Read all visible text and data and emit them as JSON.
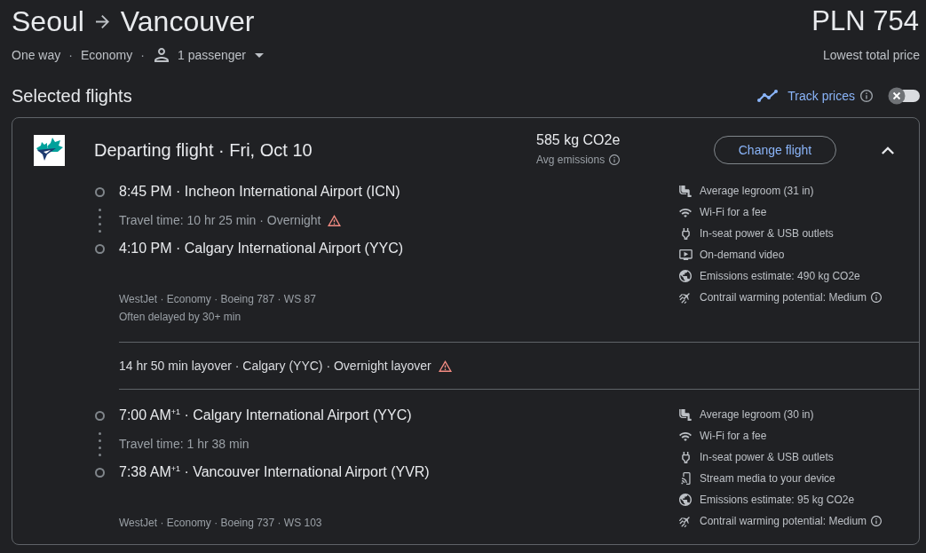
{
  "route": {
    "origin": "Seoul",
    "destination": "Vancouver"
  },
  "price": {
    "amount": "PLN 754",
    "note": "Lowest total price"
  },
  "trip_summary": [
    {
      "kind": "option",
      "label": "One way"
    },
    {
      "kind": "separator",
      "label": "·"
    },
    {
      "kind": "option",
      "label": "Economy"
    },
    {
      "kind": "separator",
      "label": "·"
    },
    {
      "kind": "passengers",
      "label": "1 passenger"
    }
  ],
  "section_title": "Selected flights",
  "track_prices": {
    "label": "Track prices",
    "on": false
  },
  "flight_card": {
    "title": "Departing flight · Fri, Oct 10",
    "emissions": {
      "value": "585 kg CO2e",
      "label": "Avg emissions"
    },
    "change_button": "Change flight",
    "expanded": true,
    "segments": [
      {
        "kind": "leg",
        "departure": "8:45 PM · Incheon International Airport (ICN)",
        "travel_time": "Travel time: 10 hr 25 min · Overnight",
        "overnight_warning": true,
        "arrival": "4:10 PM · Calgary International Airport (YYC)",
        "details": [
          "WestJet · Economy · Boeing 787 · WS 87",
          "Often delayed by 30+ min"
        ],
        "amenities": [
          {
            "kind": "legroom",
            "label": "Average legroom (31 in)",
            "info": false
          },
          {
            "kind": "wifi",
            "label": "Wi-Fi for a fee",
            "info": false
          },
          {
            "kind": "power",
            "label": "In-seat power & USB outlets",
            "info": false
          },
          {
            "kind": "video",
            "label": "On-demand video",
            "info": false
          },
          {
            "kind": "emissions",
            "label": "Emissions estimate: 490 kg CO2e",
            "info": false
          },
          {
            "kind": "contrail",
            "label": "Contrail warming potential: Medium",
            "info": true
          }
        ]
      },
      {
        "kind": "layover",
        "label": "14 hr 50 min layover · Calgary (YYC) · Overnight layover",
        "warning": true
      },
      {
        "kind": "leg",
        "departure": "7:00 AM$^{+1}$ · Calgary International Airport (YYC)",
        "travel_time": "Travel time: 1 hr 38 min",
        "overnight_warning": false,
        "arrival": "7:38 AM$^{+1}$ · Vancouver International Airport (YVR)",
        "details": [
          "WestJet · Economy · Boeing 737 · WS 103"
        ],
        "amenities": [
          {
            "kind": "legroom",
            "label": "Average legroom (30 in)",
            "info": false
          },
          {
            "kind": "wifi",
            "label": "Wi-Fi for a fee",
            "info": false
          },
          {
            "kind": "power",
            "label": "In-seat power & USB outlets",
            "info": false
          },
          {
            "kind": "stream",
            "label": "Stream media to your device",
            "info": false
          },
          {
            "kind": "emissions",
            "label": "Emissions estimate: 95 kg CO2e",
            "info": false
          },
          {
            "kind": "contrail",
            "label": "Contrail warming potential: Medium",
            "info": true
          }
        ]
      }
    ]
  }
}
